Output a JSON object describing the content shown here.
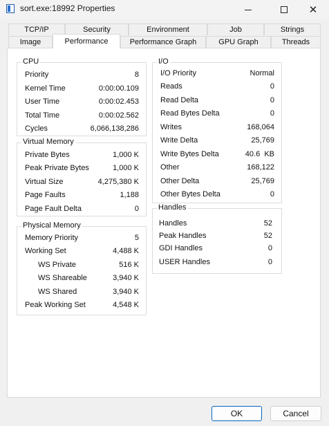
{
  "window": {
    "title": "sort.exe:18992 Properties",
    "minimize": "minimize",
    "maximize": "maximize",
    "close": "close"
  },
  "tabs_row1": [
    "TCP/IP",
    "Security",
    "Environment",
    "Job",
    "Strings"
  ],
  "tabs_row2": [
    "Image",
    "Performance",
    "Performance Graph",
    "GPU Graph",
    "Threads"
  ],
  "active_tab": "Performance",
  "cpu": {
    "title": "CPU",
    "rows": [
      {
        "label": "Priority",
        "value": "8"
      },
      {
        "label": "Kernel Time",
        "value": "0:00:00.109"
      },
      {
        "label": "User Time",
        "value": "0:00:02.453"
      },
      {
        "label": "Total Time",
        "value": "0:00:02.562"
      },
      {
        "label": "Cycles",
        "value": "6,066,138,286"
      }
    ]
  },
  "virtual_memory": {
    "title": "Virtual Memory",
    "rows": [
      {
        "label": "Private Bytes",
        "value": "1,000 K"
      },
      {
        "label": "Peak Private Bytes",
        "value": "1,000 K"
      },
      {
        "label": "Virtual Size",
        "value": "4,275,380 K"
      },
      {
        "label": "Page Faults",
        "value": "1,188"
      },
      {
        "label": "Page Fault Delta",
        "value": "0"
      }
    ]
  },
  "physical_memory": {
    "title": "Physical Memory",
    "rows": [
      {
        "label": "Memory Priority",
        "value": "5"
      },
      {
        "label": "Working Set",
        "value": "4,488 K"
      },
      {
        "label": "WS Private",
        "value": "516 K"
      },
      {
        "label": "WS Shareable",
        "value": "3,940 K"
      },
      {
        "label": "WS Shared",
        "value": "3,940 K"
      },
      {
        "label": "Peak Working Set",
        "value": "4,548 K"
      }
    ]
  },
  "io": {
    "title": "I/O",
    "rows": [
      {
        "label": "I/O Priority",
        "value": "Normal"
      },
      {
        "label": "Reads",
        "value": "0"
      },
      {
        "label": "Read Delta",
        "value": "0"
      },
      {
        "label": "Read Bytes Delta",
        "value": "0"
      },
      {
        "label": "Writes",
        "value": "168,064"
      },
      {
        "label": "Write Delta",
        "value": "25,769"
      },
      {
        "label": "Write Bytes Delta",
        "value": "40.6  KB"
      },
      {
        "label": "Other",
        "value": "168,122"
      },
      {
        "label": "Other Delta",
        "value": "25,769"
      },
      {
        "label": "Other Bytes Delta",
        "value": "0"
      }
    ]
  },
  "handles": {
    "title": "Handles",
    "rows": [
      {
        "label": "Handles",
        "value": "52"
      },
      {
        "label": "Peak Handles",
        "value": "52"
      },
      {
        "label": "GDI Handles",
        "value": "0"
      },
      {
        "label": "USER Handles",
        "value": "0"
      }
    ]
  },
  "buttons": {
    "ok": "OK",
    "cancel": "Cancel"
  }
}
